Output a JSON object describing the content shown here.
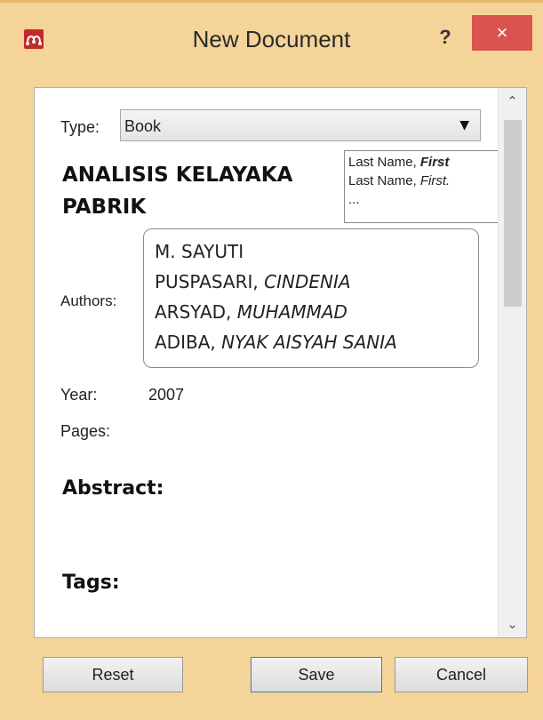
{
  "window": {
    "title": "New Document",
    "help_label": "?",
    "close_label": "×",
    "app_icon": "mendeley-logo",
    "accent": "#d9534f",
    "frame_color": "#f5d49a"
  },
  "form": {
    "type_label": "Type:",
    "type_value": "Book",
    "title_line1": "ANALISIS KELAYAKA",
    "title_line2": "PABRIK",
    "authors_label": "Authors:",
    "authors": [
      {
        "last": "M. SAYUTI",
        "first": ""
      },
      {
        "last": "PUSPASARI,",
        "first": "CINDENIA"
      },
      {
        "last": "ARSYAD,",
        "first": "MUHAMMAD"
      },
      {
        "last": "ADIBA,",
        "first": "NYAK AISYAH SANIA"
      }
    ],
    "year_label": "Year:",
    "year_value": "2007",
    "pages_label": "Pages:",
    "abstract_label": "Abstract:",
    "tags_label": "Tags:"
  },
  "tooltip": {
    "line1_last": "Last Name,",
    "line1_first": "First",
    "line2_last": "Last Name,",
    "line2_first": "First.",
    "line3": "..."
  },
  "scrollbar": {
    "up_icon": "chevron-up-icon",
    "down_icon": "chevron-down-icon"
  },
  "buttons": {
    "reset": "Reset",
    "save": "Save",
    "cancel": "Cancel"
  }
}
